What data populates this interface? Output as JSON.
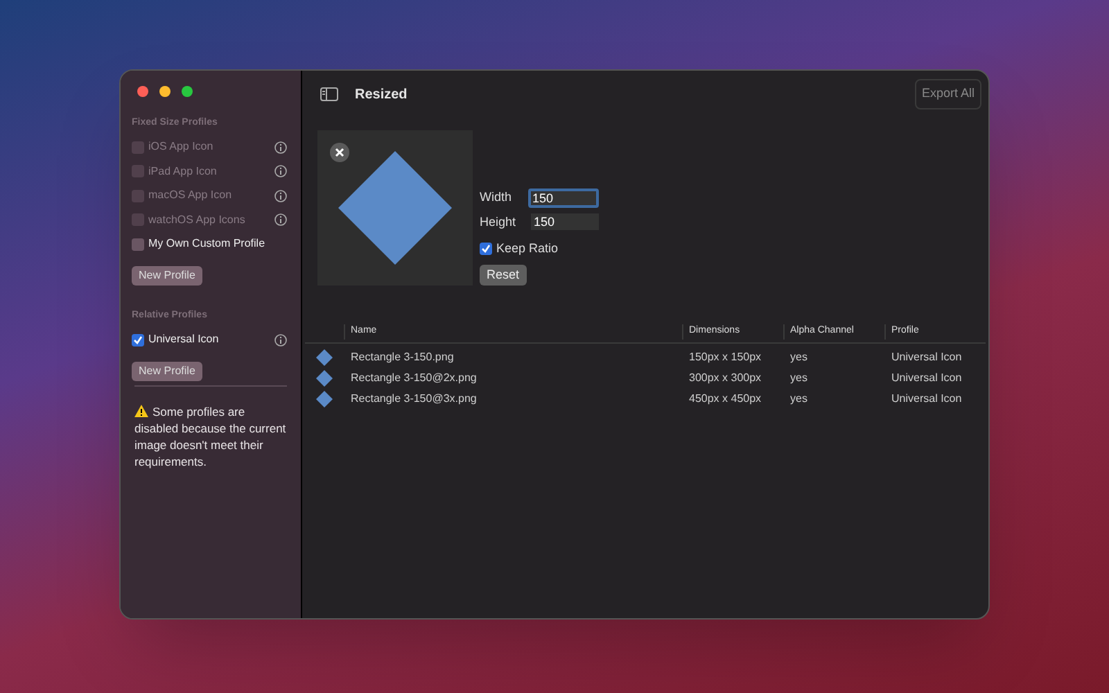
{
  "sidebar": {
    "sections": [
      {
        "title": "Fixed Size Profiles",
        "profiles": [
          {
            "label": "iOS App Icon",
            "checked": false,
            "disabled": true,
            "info": true
          },
          {
            "label": "iPad App Icon",
            "checked": false,
            "disabled": true,
            "info": true
          },
          {
            "label": "macOS App Icon",
            "checked": false,
            "disabled": true,
            "info": true
          },
          {
            "label": "watchOS App Icons",
            "checked": false,
            "disabled": true,
            "info": true
          },
          {
            "label": "My Own Custom Profile",
            "checked": false,
            "disabled": false,
            "info": false
          }
        ],
        "button": "New Profile"
      },
      {
        "title": "Relative Profiles",
        "profiles": [
          {
            "label": "Universal Icon",
            "checked": true,
            "disabled": false,
            "info": true
          }
        ],
        "button": "New Profile"
      }
    ],
    "warning": "Some profiles are disabled because the current image doesn't meet their requirements."
  },
  "toolbar": {
    "title": "Resized",
    "export_button": "Export All"
  },
  "editor": {
    "width_label": "Width",
    "width_value": "150",
    "height_label": "Height",
    "height_value": "150",
    "keep_ratio": {
      "label": "Keep Ratio",
      "checked": true
    },
    "reset_button": "Reset"
  },
  "table": {
    "columns": [
      "Name",
      "Dimensions",
      "Alpha Channel",
      "Profile"
    ],
    "rows": [
      [
        "Rectangle 3-150.png",
        "150px x 150px",
        "yes",
        "Universal Icon"
      ],
      [
        "Rectangle 3-150@2x.png",
        "300px x 300px",
        "yes",
        "Universal Icon"
      ],
      [
        "Rectangle 3-150@3x.png",
        "450px x 450px",
        "yes",
        "Universal Icon"
      ]
    ]
  }
}
